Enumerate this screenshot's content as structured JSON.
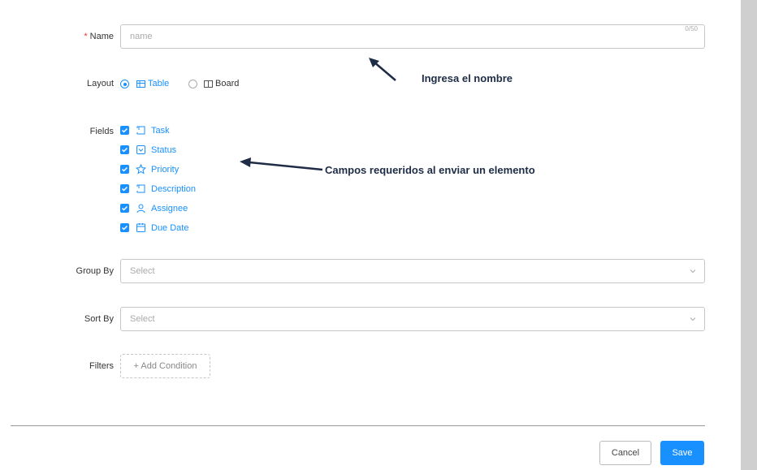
{
  "form": {
    "name": {
      "label": "Name",
      "required_mark": "*",
      "placeholder": "name",
      "value": "",
      "counter": "0/50"
    },
    "layout": {
      "label": "Layout",
      "options": [
        {
          "label": "Table",
          "icon": "table-icon",
          "selected": true
        },
        {
          "label": "Board",
          "icon": "board-icon",
          "selected": false
        }
      ]
    },
    "fields": {
      "label": "Fields",
      "items": [
        {
          "label": "Task",
          "icon": "text-icon",
          "checked": true
        },
        {
          "label": "Status",
          "icon": "dropdown-icon",
          "checked": true
        },
        {
          "label": "Priority",
          "icon": "star-icon",
          "checked": true
        },
        {
          "label": "Description",
          "icon": "text-icon",
          "checked": true
        },
        {
          "label": "Assignee",
          "icon": "user-icon",
          "checked": true
        },
        {
          "label": "Due Date",
          "icon": "calendar-icon",
          "checked": true
        }
      ]
    },
    "group_by": {
      "label": "Group By",
      "placeholder": "Select"
    },
    "sort_by": {
      "label": "Sort By",
      "placeholder": "Select"
    },
    "filters": {
      "label": "Filters",
      "button": "+ Add Condition"
    }
  },
  "footer": {
    "cancel": "Cancel",
    "save": "Save"
  },
  "annotations": {
    "name_hint": "Ingresa el nombre",
    "fields_hint": "Campos requeridos al enviar un elemento"
  },
  "colors": {
    "accent": "#1890ff",
    "required": "#e53935",
    "annotation": "#1e2c45"
  }
}
